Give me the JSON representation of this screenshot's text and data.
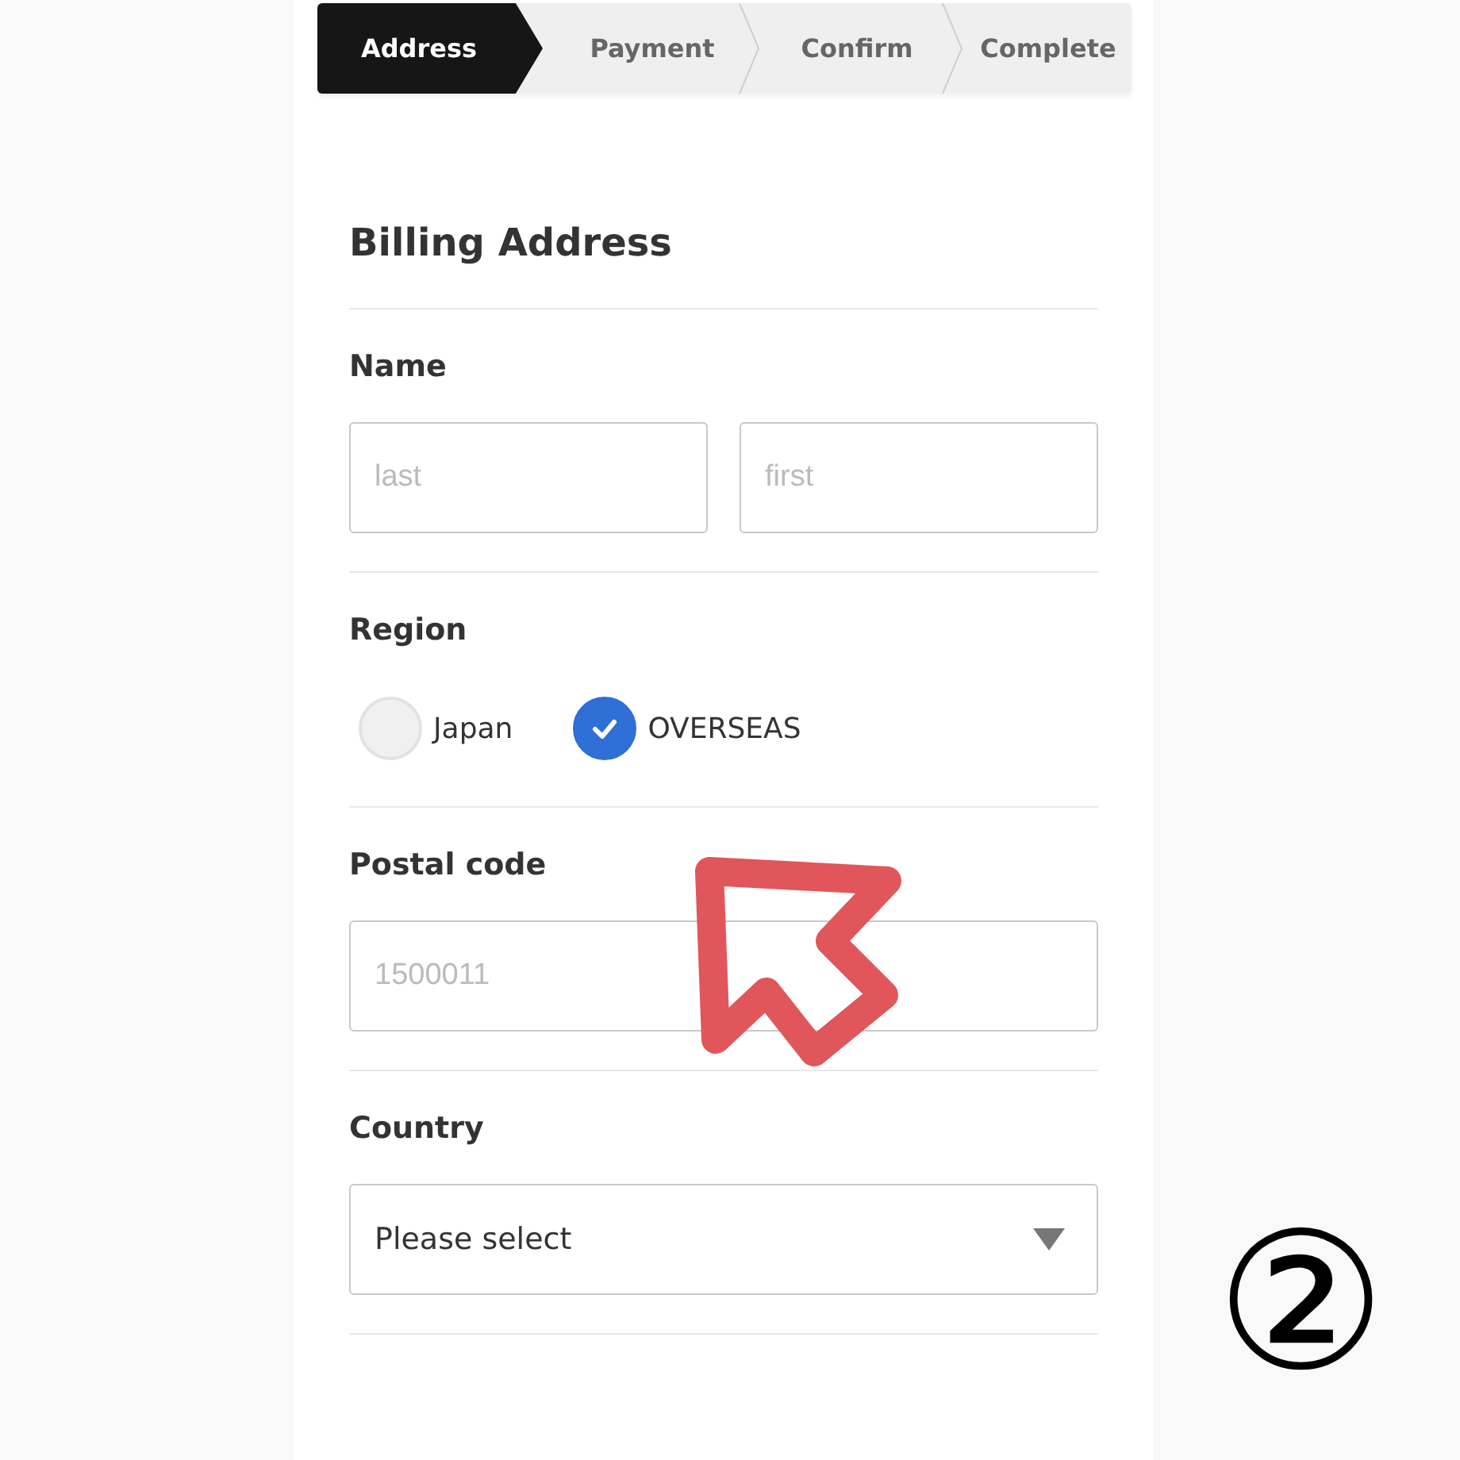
{
  "steps": [
    {
      "label": "Address",
      "selected": true
    },
    {
      "label": "Payment",
      "selected": false
    },
    {
      "label": "Confirm",
      "selected": false
    },
    {
      "label": "Complete",
      "selected": false
    }
  ],
  "section_title": "Billing Address",
  "fields": [
    {
      "kind": "inputs",
      "label": "Name",
      "inputs": [
        {
          "placeholder": "last"
        },
        {
          "placeholder": "first"
        }
      ]
    },
    {
      "kind": "radio",
      "label": "Region",
      "options": [
        {
          "label": "Japan",
          "selected": false
        },
        {
          "label": "OVERSEAS",
          "selected": true
        }
      ]
    },
    {
      "kind": "inputs",
      "label": "Postal code",
      "inputs": [
        {
          "placeholder": "1500011"
        }
      ]
    },
    {
      "kind": "select",
      "label": "Country",
      "value": "Please select"
    }
  ],
  "annotation": {
    "badge": "②"
  }
}
